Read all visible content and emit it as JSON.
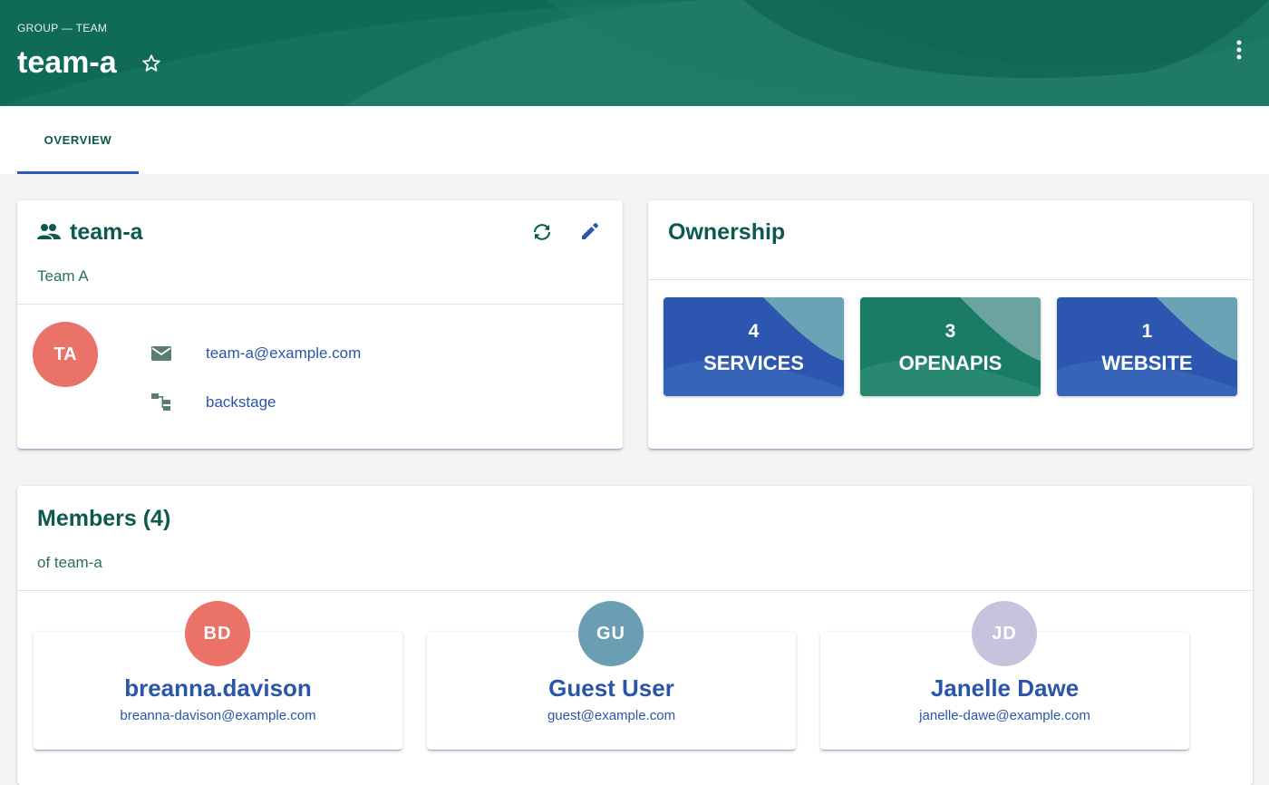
{
  "header": {
    "breadcrumb": "GROUP — TEAM",
    "title": "team-a",
    "star_icon": "star-outline-icon",
    "more_icon": "more-vertical-icon",
    "color": "#0f6b58"
  },
  "tabs": [
    {
      "label": "OVERVIEW",
      "selected": true
    }
  ],
  "team_card": {
    "title": "team-a",
    "subtitle": "Team A",
    "avatar_initials": "TA",
    "avatar_color": "#ea7268",
    "email": "team-a@example.com",
    "parent": "backstage",
    "icons": [
      "group-icon",
      "refresh-icon",
      "edit-icon",
      "email-icon",
      "hierarchy-icon"
    ]
  },
  "ownership": {
    "title": "Ownership",
    "items": [
      {
        "count": "4",
        "label": "SERVICES",
        "color": "#2c56b0"
      },
      {
        "count": "3",
        "label": "OPENAPIS",
        "color": "#1b7c66"
      },
      {
        "count": "1",
        "label": "WEBSITE",
        "color": "#2c56b0"
      }
    ]
  },
  "members": {
    "title": "Members (4)",
    "subtitle": "of team-a",
    "list": [
      {
        "initials": "BD",
        "name": "breanna.davison",
        "email": "breanna-davison@example.com",
        "color": "#ea7268"
      },
      {
        "initials": "GU",
        "name": "Guest User",
        "email": "guest@example.com",
        "color": "#6a9fb3"
      },
      {
        "initials": "JD",
        "name": "Janelle Dawe",
        "email": "janelle-dawe@example.com",
        "color": "#c6c4dc"
      }
    ]
  }
}
